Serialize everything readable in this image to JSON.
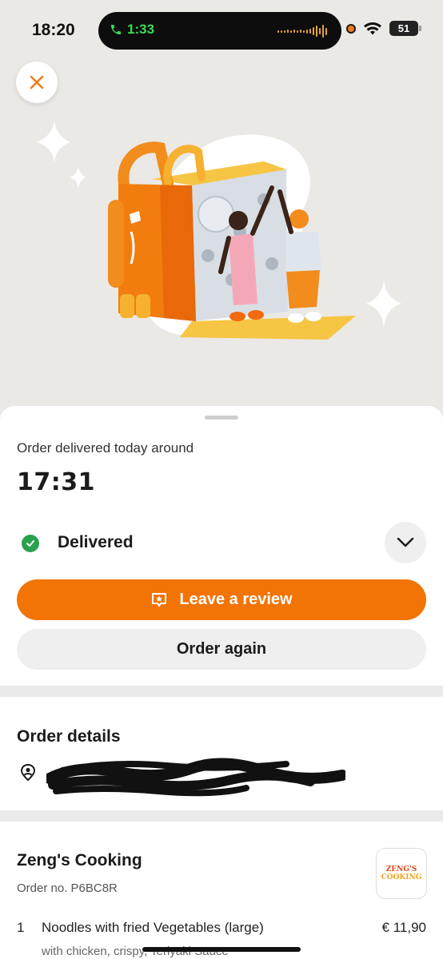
{
  "status_bar": {
    "time": "18:20",
    "call_duration": "1:33",
    "battery": "51",
    "icons": [
      "phone-icon",
      "waveform-icon",
      "recording-dot",
      "wifi-icon",
      "battery-icon"
    ]
  },
  "header": {
    "close_icon": "close-icon"
  },
  "order": {
    "delivered_label": "Order delivered today around",
    "delivered_time": "17:31",
    "status": "Delivered",
    "status_color": "#2aa14f"
  },
  "actions": {
    "review_label": "Leave a review",
    "again_label": "Order again",
    "accent_color": "#f27405"
  },
  "details": {
    "title": "Order details"
  },
  "restaurant": {
    "name": "Zeng's Cooking",
    "order_no": "Order no. P6BC8R",
    "logo_line1": "ZENG'S",
    "logo_line2": "COOKING"
  },
  "items": [
    {
      "qty": "1",
      "name": "Noodles with fried Vegetables (large)",
      "price": "€ 11,90",
      "options": "with chicken, crispy, Teriyaki Sauce"
    }
  ]
}
